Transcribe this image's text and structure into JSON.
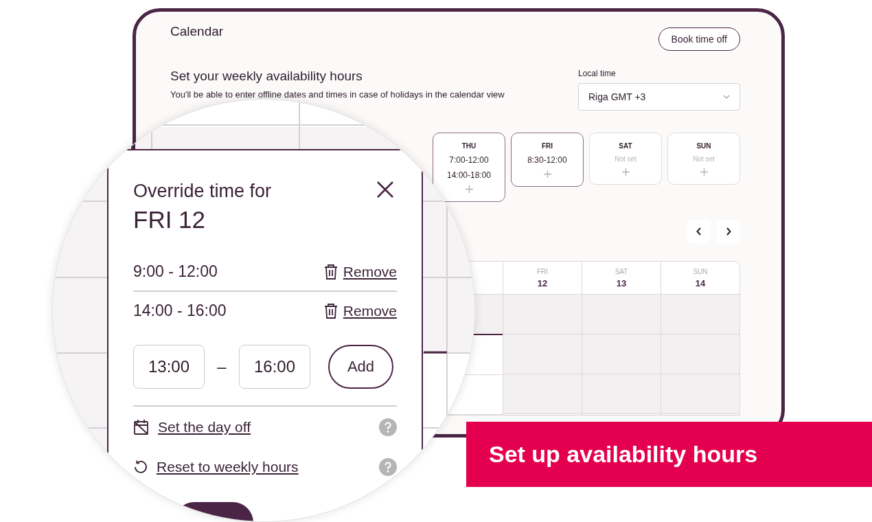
{
  "header": {
    "title": "Calendar",
    "button": "Book time off"
  },
  "availability": {
    "heading": "Set your weekly availability hours",
    "subtitle": "You'll be able to enter offline dates and times in case of holidays in the calendar view",
    "timezone": {
      "label": "Local time",
      "value": "Riga GMT +3"
    }
  },
  "days": [
    {
      "day": "THU",
      "set": true,
      "slots": [
        "7:00-12:00",
        "14:00-18:00"
      ]
    },
    {
      "day": "FRI",
      "set": true,
      "slots": [
        "8:30-12:00"
      ]
    },
    {
      "day": "SAT",
      "set": false,
      "status": "Not set"
    },
    {
      "day": "SUN",
      "set": false,
      "status": "Not set"
    }
  ],
  "calendar": {
    "columns": [
      {
        "cells": [
          {
            "available": true
          },
          {
            "available": false
          },
          {
            "available": false
          }
        ]
      },
      {
        "weekday": "FRI",
        "date": "12",
        "cells": [
          {
            "available": true
          },
          {
            "available": true
          },
          {
            "available": true
          }
        ]
      },
      {
        "weekday": "SAT",
        "date": "13",
        "cells": [
          {
            "available": true
          },
          {
            "available": true
          },
          {
            "available": true
          }
        ]
      },
      {
        "weekday": "SUN",
        "date": "14",
        "cells": [
          {
            "available": true
          },
          {
            "available": true
          },
          {
            "available": true
          }
        ]
      }
    ]
  },
  "override": {
    "title": "Override time for",
    "day": "FRI 12",
    "slots": [
      {
        "range": "9:00 - 12:00",
        "action": "Remove"
      },
      {
        "range": "14:00 - 16:00",
        "action": "Remove"
      }
    ],
    "new_slot": {
      "from": "13:00",
      "separator": "–",
      "to": "16:00",
      "button": "Add"
    },
    "options": [
      {
        "kind": "day_off",
        "label": "Set the day off"
      },
      {
        "kind": "reset",
        "label": "Reset to weekly hours"
      }
    ]
  },
  "banner": "Set up availability hours"
}
